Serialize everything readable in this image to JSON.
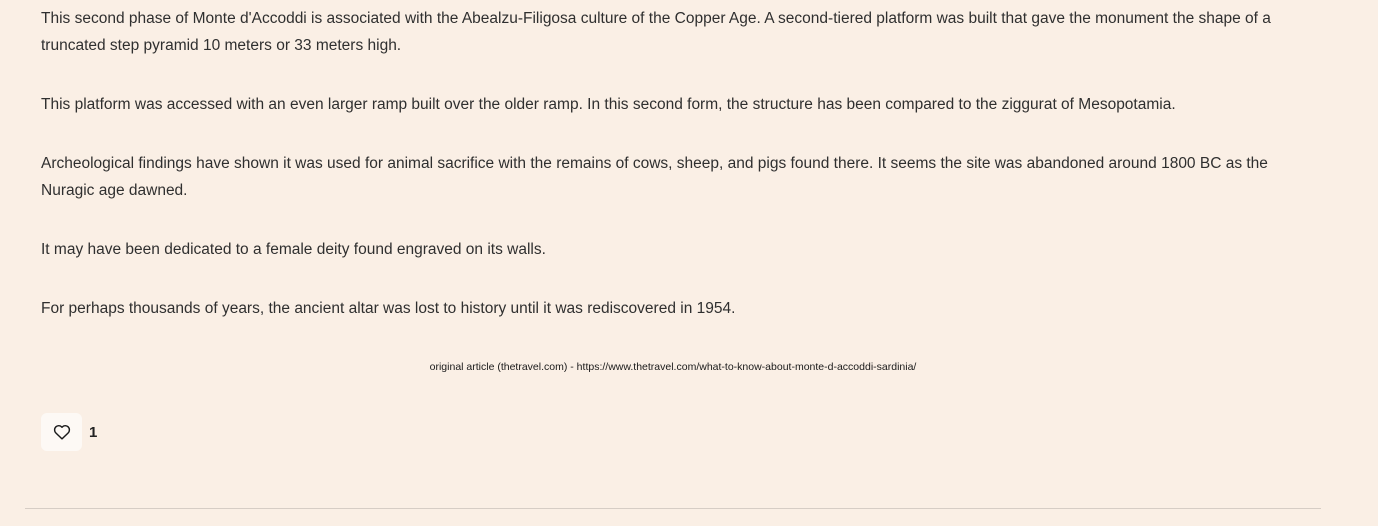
{
  "article": {
    "paragraphs": [
      "This second phase of Monte d'Accoddi is associated with the Abealzu-Filigosa culture of the Copper Age. A second-tiered platform was built that gave the monument the shape of a truncated step pyramid 10 meters or 33 meters high.",
      "This platform was accessed with an even larger ramp built over the older ramp. In this second form, the structure has been compared to the ziggurat of Mesopotamia.",
      "Archeological findings have shown it was used for animal sacrifice with the remains of cows, sheep, and pigs found there. It seems the site was abandoned around 1800 BC as the Nuragic age dawned.",
      "It may have been dedicated to a female deity found engraved on its walls.",
      "For perhaps thousands of years, the ancient altar was lost to history until it was rediscovered in 1954."
    ],
    "source_text": "original article (thetravel.com) - https://www.thetravel.com/what-to-know-about-monte-d-accoddi-sardinia/"
  },
  "likes": {
    "icon": "heart-icon",
    "count": "1"
  },
  "colors": {
    "background": "#faefe5",
    "text": "#2f2f2f",
    "divider": "#d6cdc5"
  }
}
